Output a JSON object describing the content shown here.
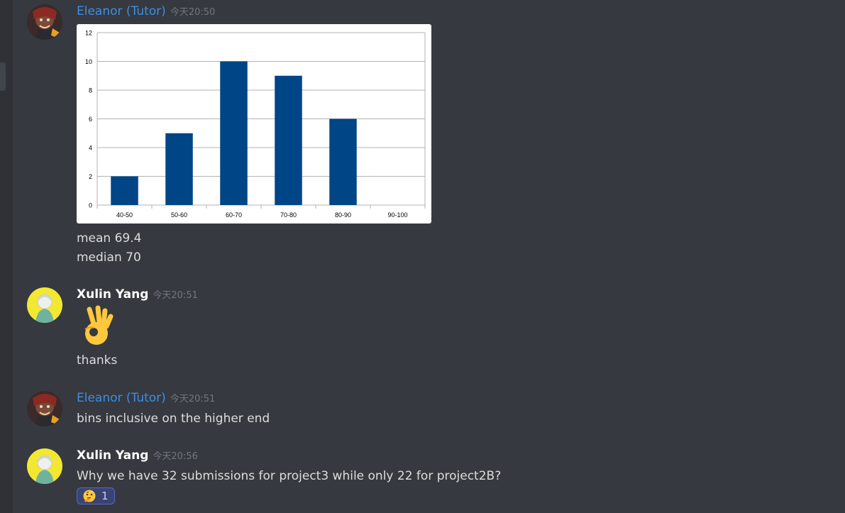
{
  "messages": [
    {
      "author": "Eleanor (Tutor)",
      "time": "今天20:50",
      "lines": [
        "mean 69.4",
        "median 70"
      ]
    },
    {
      "author": "Xulin Yang",
      "time": "今天20:51",
      "emoji": "ok-hand",
      "lines": [
        "thanks"
      ]
    },
    {
      "author": "Eleanor (Tutor)",
      "time": "今天20:51",
      "lines": [
        "bins inclusive on the higher end"
      ]
    },
    {
      "author": "Xulin Yang",
      "time": "今天20:56",
      "lines": [
        "Why we have 32 submissions for project3 while only 22 for project2B?"
      ],
      "reaction": {
        "emoji": "thinking-face",
        "count": "1"
      }
    }
  ],
  "colors": {
    "tutor_name": "#3d8ee3",
    "bar": "#004586"
  },
  "chart_data": {
    "type": "bar",
    "categories": [
      "40-50",
      "50-60",
      "60-70",
      "70-80",
      "80-90",
      "90-100"
    ],
    "values": [
      2,
      5,
      10,
      9,
      6,
      0
    ],
    "ylim": [
      0,
      12
    ],
    "yticks": [
      "0",
      "2",
      "4",
      "6",
      "8",
      "10",
      "12"
    ],
    "grid": true
  }
}
